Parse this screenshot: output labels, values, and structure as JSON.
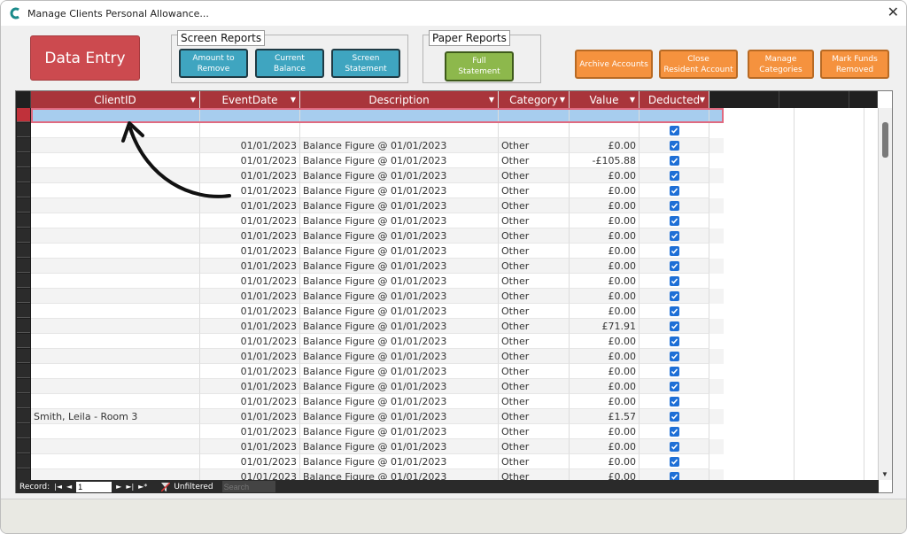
{
  "window": {
    "title": "Manage Clients Personal Allowance..."
  },
  "toolbar": {
    "data_entry": "Data Entry",
    "screen_reports_label": "Screen Reports",
    "amount_to_remove": "Amount to\nRemove",
    "current_balance": "Current\nBalance",
    "screen_statement": "Screen\nStatement",
    "paper_reports_label": "Paper Reports",
    "full_statement": "Full\nStatement",
    "archive_accounts": "Archive Accounts",
    "close_resident_account": "Close\nResident Account",
    "manage_categories": "Manage\nCategories",
    "mark_funds_removed": "Mark Funds\nRemoved"
  },
  "grid": {
    "headers": {
      "client": "ClientID",
      "date": "EventDate",
      "desc": "Description",
      "cat": "Category",
      "val": "Value",
      "ded": "Deducted"
    },
    "rows": [
      {
        "client": "",
        "date": "",
        "desc": "",
        "cat": "",
        "val": "",
        "ded": false
      },
      {
        "client": "",
        "date": "",
        "desc": "",
        "cat": "",
        "val": "",
        "ded": true
      },
      {
        "client": "",
        "date": "01/01/2023",
        "desc": "Balance Figure @ 01/01/2023",
        "cat": "Other",
        "val": "£0.00",
        "ded": true
      },
      {
        "client": "",
        "date": "01/01/2023",
        "desc": "Balance Figure @ 01/01/2023",
        "cat": "Other",
        "val": "-£105.88",
        "ded": true
      },
      {
        "client": "",
        "date": "01/01/2023",
        "desc": "Balance Figure @ 01/01/2023",
        "cat": "Other",
        "val": "£0.00",
        "ded": true
      },
      {
        "client": "",
        "date": "01/01/2023",
        "desc": "Balance Figure @ 01/01/2023",
        "cat": "Other",
        "val": "£0.00",
        "ded": true
      },
      {
        "client": "",
        "date": "01/01/2023",
        "desc": "Balance Figure @ 01/01/2023",
        "cat": "Other",
        "val": "£0.00",
        "ded": true
      },
      {
        "client": "",
        "date": "01/01/2023",
        "desc": "Balance Figure @ 01/01/2023",
        "cat": "Other",
        "val": "£0.00",
        "ded": true
      },
      {
        "client": "",
        "date": "01/01/2023",
        "desc": "Balance Figure @ 01/01/2023",
        "cat": "Other",
        "val": "£0.00",
        "ded": true
      },
      {
        "client": "",
        "date": "01/01/2023",
        "desc": "Balance Figure @ 01/01/2023",
        "cat": "Other",
        "val": "£0.00",
        "ded": true
      },
      {
        "client": "",
        "date": "01/01/2023",
        "desc": "Balance Figure @ 01/01/2023",
        "cat": "Other",
        "val": "£0.00",
        "ded": true
      },
      {
        "client": "",
        "date": "01/01/2023",
        "desc": "Balance Figure @ 01/01/2023",
        "cat": "Other",
        "val": "£0.00",
        "ded": true
      },
      {
        "client": "",
        "date": "01/01/2023",
        "desc": "Balance Figure @ 01/01/2023",
        "cat": "Other",
        "val": "£0.00",
        "ded": true
      },
      {
        "client": "",
        "date": "01/01/2023",
        "desc": "Balance Figure @ 01/01/2023",
        "cat": "Other",
        "val": "£0.00",
        "ded": true
      },
      {
        "client": "",
        "date": "01/01/2023",
        "desc": "Balance Figure @ 01/01/2023",
        "cat": "Other",
        "val": "£71.91",
        "ded": true
      },
      {
        "client": "",
        "date": "01/01/2023",
        "desc": "Balance Figure @ 01/01/2023",
        "cat": "Other",
        "val": "£0.00",
        "ded": true
      },
      {
        "client": "",
        "date": "01/01/2023",
        "desc": "Balance Figure @ 01/01/2023",
        "cat": "Other",
        "val": "£0.00",
        "ded": true
      },
      {
        "client": "",
        "date": "01/01/2023",
        "desc": "Balance Figure @ 01/01/2023",
        "cat": "Other",
        "val": "£0.00",
        "ded": true
      },
      {
        "client": "",
        "date": "01/01/2023",
        "desc": "Balance Figure @ 01/01/2023",
        "cat": "Other",
        "val": "£0.00",
        "ded": true
      },
      {
        "client": "",
        "date": "01/01/2023",
        "desc": "Balance Figure @ 01/01/2023",
        "cat": "Other",
        "val": "£0.00",
        "ded": true
      },
      {
        "client": "Smith, Leila - Room 3",
        "date": "01/01/2023",
        "desc": "Balance Figure @ 01/01/2023",
        "cat": "Other",
        "val": "£1.57",
        "ded": true
      },
      {
        "client": "",
        "date": "01/01/2023",
        "desc": "Balance Figure @ 01/01/2023",
        "cat": "Other",
        "val": "£0.00",
        "ded": true
      },
      {
        "client": "",
        "date": "01/01/2023",
        "desc": "Balance Figure @ 01/01/2023",
        "cat": "Other",
        "val": "£0.00",
        "ded": true
      },
      {
        "client": "",
        "date": "01/01/2023",
        "desc": "Balance Figure @ 01/01/2023",
        "cat": "Other",
        "val": "£0.00",
        "ded": true
      },
      {
        "client": "",
        "date": "01/01/2023",
        "desc": "Balance Figure @ 01/01/2023",
        "cat": "Other",
        "val": "£0.00",
        "ded": true
      }
    ]
  },
  "navbar": {
    "record_label": "Record:",
    "record_value": "1",
    "filter_label": "Unfiltered",
    "search_placeholder": "Search"
  },
  "colors": {
    "header": "#a9353b",
    "data_entry": "#cc4a4f",
    "teal": "#3fa5c0",
    "green": "#8db84c",
    "orange": "#f5923e",
    "selected_row": "#a7cdee"
  }
}
